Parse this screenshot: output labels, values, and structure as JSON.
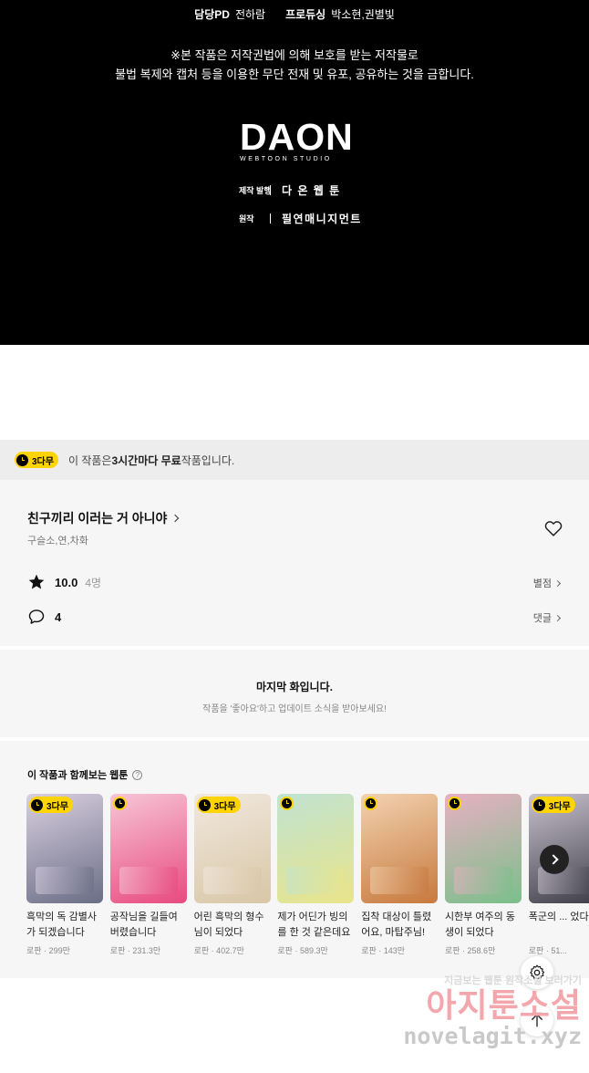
{
  "credits": {
    "pd_label": "담당PD",
    "pd_name": "전하람",
    "producer_label": "프로듀싱",
    "producer_name": "박소현,권별빛",
    "notice_line1": "※본 작품은 저작권법에 의해 보호를 받는 저작물로",
    "notice_line2": "불법 복제와 캡처 등을 이용한 무단 전재 및 유포, 공유하는 것을 금합니다.",
    "logo_main": "DAON",
    "logo_sub": "WEBTOON STUDIO",
    "production_label": "제작 발행",
    "production_value": "다 온 웹 툰",
    "original_label": "원작",
    "original_value": "필연매니지먼트"
  },
  "free_banner": {
    "badge": "3다무",
    "text_pre": "이 작품은 ",
    "text_bold": "3시간마다 무료",
    "text_post": " 작품입니다."
  },
  "work": {
    "title": "친구끼리 이러는 거 아니야",
    "authors": "구슬소,연,차화",
    "rating": "10.0",
    "rating_count": "4명",
    "rating_link": "별점",
    "comment_count": "4",
    "comment_link": "댓글"
  },
  "last_episode": {
    "title": "마지막 화입니다.",
    "subtitle": "작품을 '좋아요'하고 업데이트 소식을 받아보세요!"
  },
  "recommendations": {
    "heading": "이 작품과 함께보는 웹툰",
    "help_glyph": "?",
    "badge_label": "3다무",
    "items": [
      {
        "title": "흑막의 독 감별사가 되겠습니다",
        "meta": "로판 · 299만",
        "badge": "3다무",
        "colors": [
          "#6b6e86",
          "#d9cfe0"
        ]
      },
      {
        "title": "공작님을 길들여 버렸습니다",
        "meta": "로판 · 231.3만",
        "badge": "clock",
        "colors": [
          "#e84a7f",
          "#f6c6d6"
        ]
      },
      {
        "title": "어린 흑막의 형수님이 되었다",
        "meta": "로판 · 402.7만",
        "badge": "3다무",
        "colors": [
          "#d8c7a6",
          "#f1e8de"
        ]
      },
      {
        "title": "제가 어딘가 빙의를 한 것 같은데요",
        "meta": "로판 · 589.3만",
        "badge": "clock",
        "colors": [
          "#e9e48a",
          "#bfe3d2"
        ]
      },
      {
        "title": "집착 대상이 틀렸어요, 마탑주님!",
        "meta": "로판 · 143만",
        "badge": "clock",
        "colors": [
          "#c7793d",
          "#f2d2b0"
        ]
      },
      {
        "title": "시한부 여주의 동생이 되었다",
        "meta": "로판 · 258.6만",
        "badge": "clock",
        "colors": [
          "#7bbf8a",
          "#e7b0c2"
        ]
      },
      {
        "title": "폭군의 ... 었다",
        "meta": "로판 · 51...",
        "badge": "3다무",
        "colors": [
          "#3c3c46",
          "#c9c2cf"
        ]
      }
    ]
  },
  "watermark": {
    "line1": "지금보는 웹툰 원작소설 보러가기",
    "line2": "아지툰소설",
    "line3": "novelagit.xyz"
  }
}
